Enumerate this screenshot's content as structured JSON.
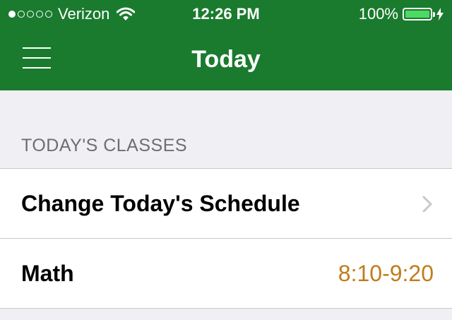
{
  "status_bar": {
    "carrier": "Verizon",
    "signal_bars": 1,
    "signal_max": 5,
    "time": "12:26 PM",
    "battery_percent": "100%"
  },
  "navbar": {
    "title": "Today",
    "menu_icon": "hamburger-menu-icon"
  },
  "section": {
    "header": "TODAY'S CLASSES"
  },
  "rows": [
    {
      "label": "Change Today's Schedule",
      "accessory": "chevron-right-icon"
    },
    {
      "label": "Math",
      "detail": "8:10-9:20"
    }
  ],
  "colors": {
    "nav_green": "#1a7b2e",
    "detail_orange": "#bf7d1c",
    "battery_green": "#4cd964"
  }
}
